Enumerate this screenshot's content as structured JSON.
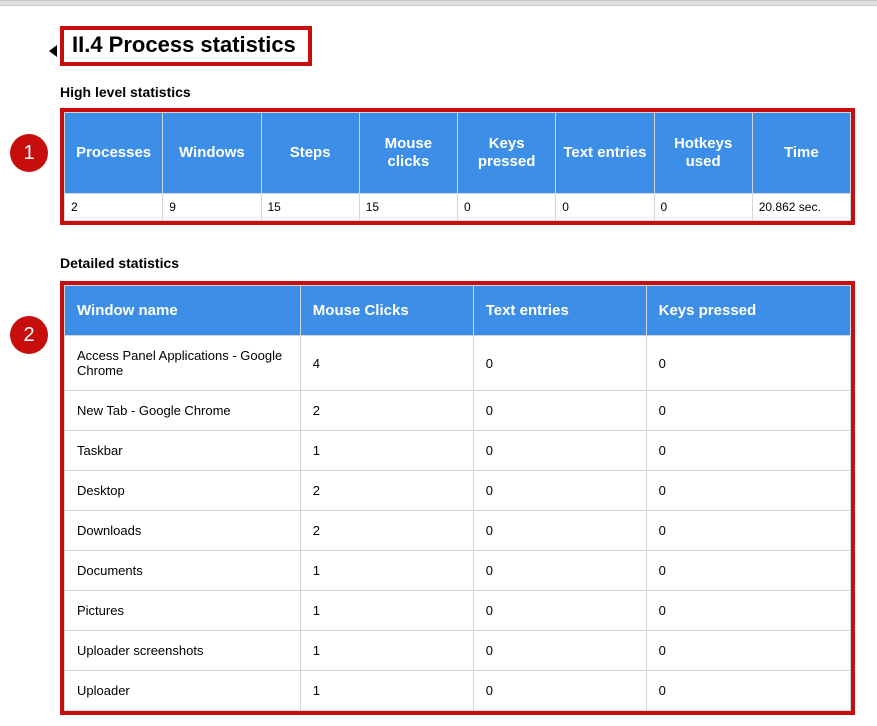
{
  "section_heading": "II.4 Process statistics",
  "high_level": {
    "title": "High level statistics",
    "headers": [
      "Processes",
      "Windows",
      "Steps",
      "Mouse clicks",
      "Keys pressed",
      "Text entries",
      "Hotkeys used",
      "Time"
    ],
    "row": [
      "2",
      "9",
      "15",
      "15",
      "0",
      "0",
      "0",
      "20.862 sec."
    ]
  },
  "detailed": {
    "title": "Detailed statistics",
    "headers": [
      "Window name",
      "Mouse Clicks",
      "Text entries",
      "Keys pressed"
    ],
    "rows": [
      {
        "window": "Access Panel Applications - Google Chrome",
        "mouse": "4",
        "text": "0",
        "keys": "0"
      },
      {
        "window": "New Tab - Google Chrome",
        "mouse": "2",
        "text": "0",
        "keys": "0"
      },
      {
        "window": "Taskbar",
        "mouse": "1",
        "text": "0",
        "keys": "0"
      },
      {
        "window": "Desktop",
        "mouse": "2",
        "text": "0",
        "keys": "0"
      },
      {
        "window": "Downloads",
        "mouse": "2",
        "text": "0",
        "keys": "0"
      },
      {
        "window": "Documents",
        "mouse": "1",
        "text": "0",
        "keys": "0"
      },
      {
        "window": "Pictures",
        "mouse": "1",
        "text": "0",
        "keys": "0"
      },
      {
        "window": "Uploader screenshots",
        "mouse": "1",
        "text": "0",
        "keys": "0"
      },
      {
        "window": "Uploader",
        "mouse": "1",
        "text": "0",
        "keys": "0"
      }
    ]
  },
  "callouts": {
    "one": "1",
    "two": "2"
  }
}
